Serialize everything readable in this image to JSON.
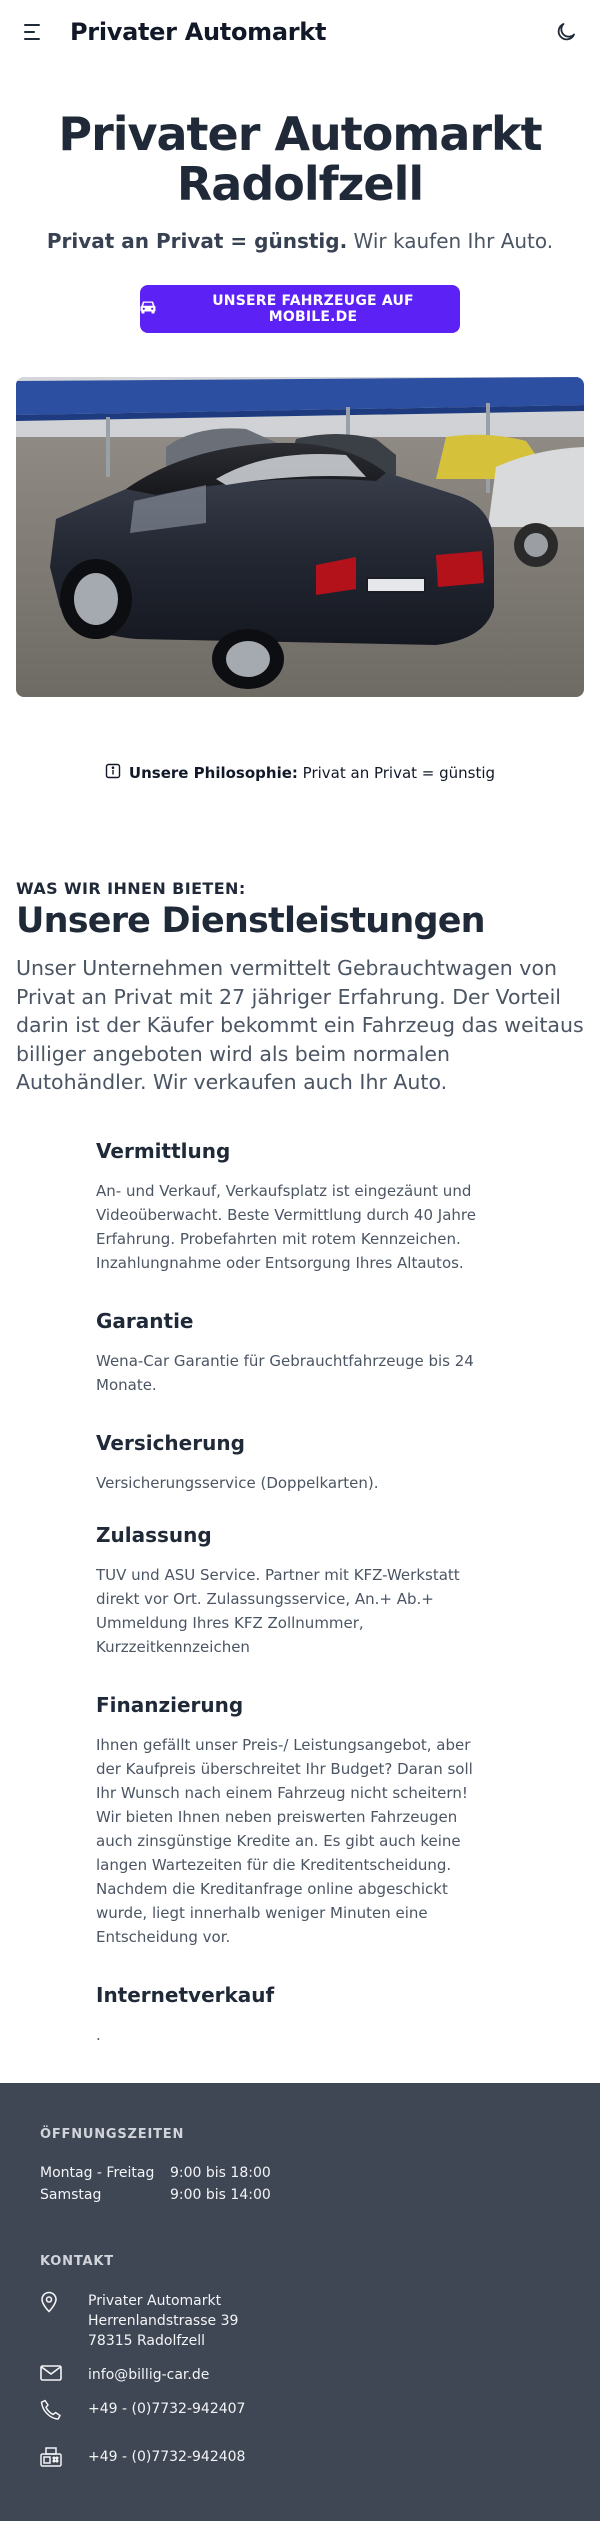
{
  "header": {
    "brand": "Privater Automarkt",
    "menu_icon": "menu-icon",
    "theme_icon": "moon-icon"
  },
  "hero": {
    "title_line1": "Privater Automarkt",
    "title_line2": "Radolfzell",
    "tagline_bold": "Privat an Privat = günstig.",
    "tagline_rest": " Wir kaufen Ihr Auto.",
    "cta_label": "Unsere Fahrzeuge auf mobile.de",
    "cta_icon": "car-icon",
    "accent": "#5b21f5"
  },
  "philosophy": {
    "icon": "info-icon",
    "label": "Unsere Philosophie:",
    "text": " Privat an Privat = günstig"
  },
  "services": {
    "eyebrow": "WAS WIR IHNEN BIETEN:",
    "title": "Unsere Dienstleistungen",
    "intro": "Unser Unternehmen vermittelt Gebrauchtwagen von Privat an Privat mit 27 jähriger Erfahrung. Der Vorteil darin ist der Käufer bekommt ein Fahrzeug das weitaus billiger angeboten wird als beim normalen Autohändler. Wir verkaufen auch Ihr Auto.",
    "items": [
      {
        "title": "Vermittlung",
        "text": "An- und Verkauf, Verkaufsplatz ist eingezäunt und Videoüberwacht. Beste Vermittlung durch 40 Jahre Erfahrung. Probefahrten mit rotem Kennzeichen. Inzahlungnahme oder Entsorgung Ihres Altautos."
      },
      {
        "title": "Garantie",
        "text": "Wena-Car Garantie für Gebrauchtfahrzeuge bis 24 Monate."
      },
      {
        "title": "Versicherung",
        "text": "Versicherungsservice (Doppelkarten)."
      },
      {
        "title": "Zulassung",
        "text": "TUV und ASU Service. Partner mit KFZ-Werkstatt direkt vor Ort. Zulassungsservice, An.+ Ab.+ Ummeldung Ihres KFZ Zollnummer, Kurzzeitkennzeichen"
      },
      {
        "title": "Finanzierung",
        "text": "Ihnen gefällt unser Preis-/ Leistungsangebot, aber der Kaufpreis überschreitet Ihr Budget? Daran soll Ihr Wunsch nach einem Fahrzeug nicht scheitern! Wir bieten Ihnen neben preiswerten Fahrzeugen auch zinsgünstige Kredite an. Es gibt auch keine langen Wartezeiten für die Kreditentscheidung. Nachdem die Kreditanfrage online abgeschickt wurde, liegt innerhalb weniger Minuten eine Entscheidung vor."
      },
      {
        "title": "Internetverkauf",
        "text": "."
      }
    ]
  },
  "footer": {
    "hours_title": "Öffnungszeiten",
    "hours": [
      {
        "day": "Montag - Freitag",
        "time": "9:00 bis 18:00"
      },
      {
        "day": "Samstag",
        "time": "9:00 bis 14:00"
      }
    ],
    "contact_title": "Kontakt",
    "address_line1": "Privater Automarkt",
    "address_line2": "Herrenlandstrasse 39",
    "address_line3": "78315 Radolfzell",
    "email": "info@billig-car.de",
    "phone": "+49 - (0)7732-942407",
    "fax": "+49 - (0)7732-942408",
    "background": "#3f4654"
  }
}
